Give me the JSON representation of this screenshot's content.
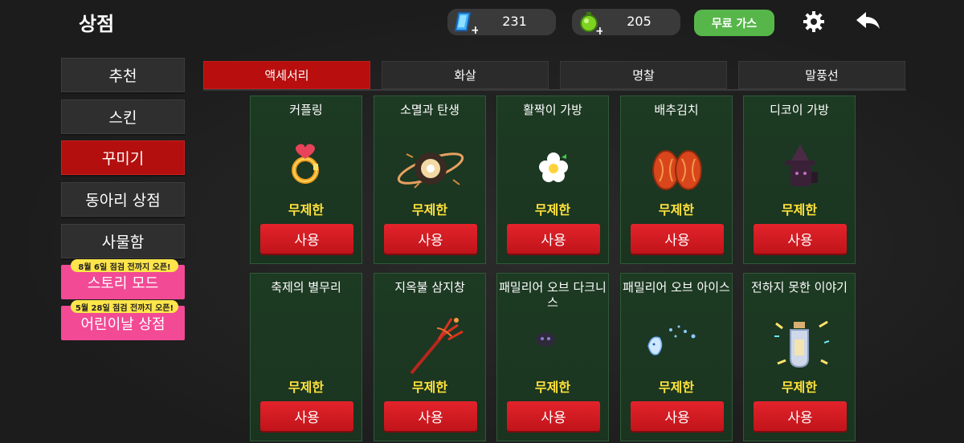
{
  "header": {
    "title": "상점",
    "gems": "231",
    "coins": "205",
    "free_gas": "무료 가스"
  },
  "sidebar": {
    "items": [
      {
        "label": "추천",
        "active": false
      },
      {
        "label": "스킨",
        "active": false
      },
      {
        "label": "꾸미기",
        "active": true
      },
      {
        "label": "동아리 상점",
        "active": false
      },
      {
        "label": "사물함",
        "active": false
      }
    ],
    "events": [
      {
        "badge": "8월 6일 점검 전까지 오픈!",
        "label": "스토리 모드"
      },
      {
        "badge": "5월 28일 점검 전까지 오픈!",
        "label": "어린이날 상점"
      }
    ]
  },
  "tabs": [
    {
      "label": "액세서리",
      "active": true
    },
    {
      "label": "화살",
      "active": false
    },
    {
      "label": "명찰",
      "active": false
    },
    {
      "label": "말풍선",
      "active": false
    }
  ],
  "items": [
    {
      "name": "커플링",
      "duration": "무제한",
      "action": "사용",
      "icon": "ring-icon"
    },
    {
      "name": "소멸과 탄생",
      "duration": "무제한",
      "action": "사용",
      "icon": "planet-icon"
    },
    {
      "name": "활짝이 가방",
      "duration": "무제한",
      "action": "사용",
      "icon": "flower-bag-icon"
    },
    {
      "name": "배추김치",
      "duration": "무제한",
      "action": "사용",
      "icon": "kimchi-icon"
    },
    {
      "name": "디코이 가방",
      "duration": "무제한",
      "action": "사용",
      "icon": "witch-bag-icon"
    },
    {
      "name": "축제의 별무리",
      "duration": "무제한",
      "action": "사용",
      "icon": "star-cluster-icon"
    },
    {
      "name": "지옥불 삼지창",
      "duration": "무제한",
      "action": "사용",
      "icon": "trident-icon"
    },
    {
      "name": "패밀리어 오브 다크니스",
      "duration": "무제한",
      "action": "사용",
      "icon": "dark-familiar-icon"
    },
    {
      "name": "패밀리어 오브 아이스",
      "duration": "무제한",
      "action": "사용",
      "icon": "ice-familiar-icon"
    },
    {
      "name": "전하지 못한 이야기",
      "duration": "무제한",
      "action": "사용",
      "icon": "bottle-letter-icon"
    }
  ]
}
